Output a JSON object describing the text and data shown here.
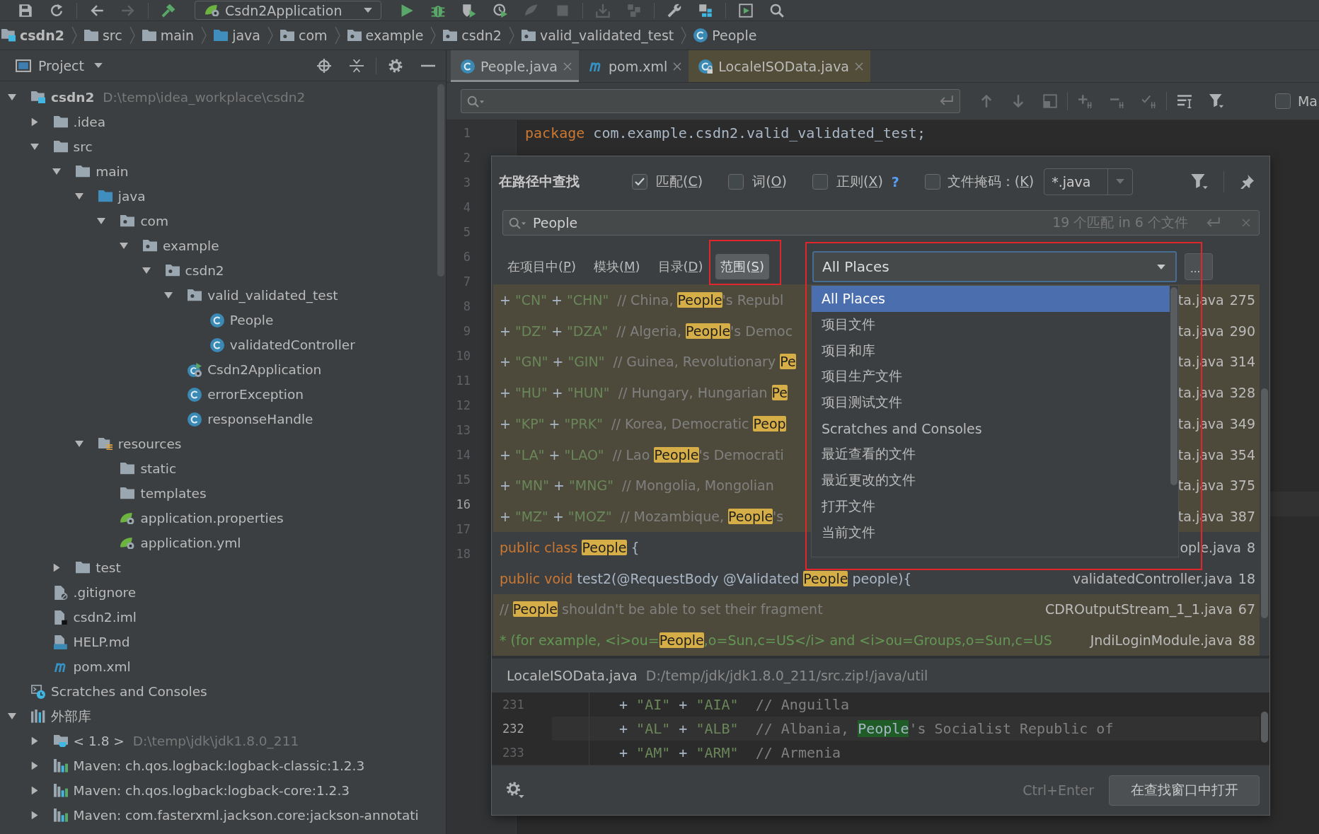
{
  "toolbar": {
    "left_buttons": [
      {
        "kind": "save",
        "disabled": false
      },
      {
        "kind": "refresh",
        "disabled": false
      },
      {
        "kind": "separator"
      },
      {
        "kind": "back",
        "disabled": false
      },
      {
        "kind": "forward",
        "disabled": true
      },
      {
        "kind": "separator"
      },
      {
        "kind": "build",
        "disabled": false
      }
    ],
    "run_configuration": "Csdn2Application",
    "right_buttons": [
      {
        "kind": "run",
        "disabled": false
      },
      {
        "kind": "debug",
        "disabled": false
      },
      {
        "kind": "coverage",
        "disabled": false
      },
      {
        "kind": "profile",
        "disabled": false
      },
      {
        "kind": "attach",
        "disabled": true
      },
      {
        "kind": "stop",
        "disabled": true
      },
      {
        "kind": "separator"
      },
      {
        "kind": "deploy",
        "disabled": true
      },
      {
        "kind": "modules",
        "disabled": true
      },
      {
        "kind": "separator"
      },
      {
        "kind": "settings",
        "disabled": false
      },
      {
        "kind": "structure",
        "disabled": false
      },
      {
        "kind": "separator"
      },
      {
        "kind": "run_window",
        "disabled": false
      },
      {
        "kind": "search",
        "disabled": false
      }
    ]
  },
  "breadcrumb": [
    {
      "label": "csdn2",
      "kind": "module"
    },
    {
      "label": "src",
      "kind": "folder"
    },
    {
      "label": "main",
      "kind": "folder"
    },
    {
      "label": "java",
      "kind": "source_folder"
    },
    {
      "label": "com",
      "kind": "package"
    },
    {
      "label": "example",
      "kind": "package"
    },
    {
      "label": "csdn2",
      "kind": "package"
    },
    {
      "label": "valid_validated_test",
      "kind": "package"
    },
    {
      "label": "People",
      "kind": "class"
    }
  ],
  "project_panel": {
    "title": "Project",
    "tree": [
      {
        "label": "csdn2",
        "kind": "module",
        "path": "D:\\temp\\idea_workplace\\csdn2",
        "expanded": true,
        "children": [
          {
            "label": ".idea",
            "kind": "folder",
            "expanded": false
          },
          {
            "label": "src",
            "kind": "folder",
            "expanded": true,
            "children": [
              {
                "label": "main",
                "kind": "folder",
                "expanded": true,
                "children": [
                  {
                    "label": "java",
                    "kind": "source_folder",
                    "expanded": true,
                    "children": [
                      {
                        "label": "com",
                        "kind": "package",
                        "expanded": true,
                        "children": [
                          {
                            "label": "example",
                            "kind": "package",
                            "expanded": true,
                            "children": [
                              {
                                "label": "csdn2",
                                "kind": "package",
                                "expanded": true,
                                "children": [
                                  {
                                    "label": "valid_validated_test",
                                    "kind": "package",
                                    "expanded": true,
                                    "children": [
                                      {
                                        "label": "People",
                                        "kind": "class"
                                      },
                                      {
                                        "label": "validatedController",
                                        "kind": "class"
                                      }
                                    ]
                                  },
                                  {
                                    "label": "Csdn2Application",
                                    "kind": "spring_class"
                                  },
                                  {
                                    "label": "errorException",
                                    "kind": "class"
                                  },
                                  {
                                    "label": "responseHandle",
                                    "kind": "class"
                                  }
                                ]
                              }
                            ]
                          }
                        ]
                      }
                    ]
                  },
                  {
                    "label": "resources",
                    "kind": "resources_folder",
                    "expanded": true,
                    "children": [
                      {
                        "label": "static",
                        "kind": "folder"
                      },
                      {
                        "label": "templates",
                        "kind": "folder"
                      },
                      {
                        "label": "application.properties",
                        "kind": "spring_config"
                      },
                      {
                        "label": "application.yml",
                        "kind": "spring_config"
                      }
                    ]
                  }
                ]
              },
              {
                "label": "test",
                "kind": "folder",
                "expanded": false
              }
            ]
          },
          {
            "label": ".gitignore",
            "kind": "ignore_file"
          },
          {
            "label": "csdn2.iml",
            "kind": "iml_file"
          },
          {
            "label": "HELP.md",
            "kind": "markdown_file"
          },
          {
            "label": "pom.xml",
            "kind": "maven_file"
          }
        ]
      },
      {
        "label": "Scratches and Consoles",
        "kind": "scratches"
      },
      {
        "label": "外部库",
        "kind": "libraries",
        "expanded": true,
        "children": [
          {
            "label": "< 1.8 >",
            "kind": "jdk",
            "path": "D:\\temp\\jdk\\jdk1.8.0_211",
            "expanded": false
          },
          {
            "label": "Maven: ch.qos.logback:logback-classic:1.2.3",
            "kind": "library",
            "expanded": false
          },
          {
            "label": "Maven: ch.qos.logback:logback-core:1.2.3",
            "kind": "library",
            "expanded": false
          },
          {
            "label": "Maven: com.fasterxml.jackson.core:jackson-annotati",
            "kind": "library",
            "expanded": false
          }
        ]
      }
    ]
  },
  "editor": {
    "tabs": [
      {
        "label": "People.java",
        "kind": "class",
        "selected": true,
        "library": false
      },
      {
        "label": "pom.xml",
        "kind": "maven_file",
        "selected": false,
        "library": false
      },
      {
        "label": "LocaleISOData.java",
        "kind": "locked_class",
        "selected": false,
        "library": true
      }
    ],
    "find_bar": {
      "match_case": {
        "label": "Ma",
        "checked": false
      }
    },
    "lines": [
      {
        "number": "1",
        "current": false,
        "code": [
          {
            "kind": "keyword",
            "text": "package"
          },
          {
            "kind": "plain",
            "text": " com.example.csdn2.valid_validated_test;"
          }
        ]
      },
      {
        "number": "2",
        "current": false
      },
      {
        "number": "3",
        "current": false
      },
      {
        "number": "4",
        "current": false
      },
      {
        "number": "5",
        "current": false
      },
      {
        "number": "6",
        "current": false
      },
      {
        "number": "7",
        "current": false
      },
      {
        "number": "8",
        "current": false
      },
      {
        "number": "9",
        "current": false
      },
      {
        "number": "10",
        "current": false
      },
      {
        "number": "11",
        "current": false
      },
      {
        "number": "12",
        "current": false
      },
      {
        "number": "13",
        "current": false
      },
      {
        "number": "14",
        "current": false
      },
      {
        "number": "15",
        "current": false
      },
      {
        "number": "16",
        "current": true
      },
      {
        "number": "17",
        "current": false
      },
      {
        "number": "18",
        "current": false
      }
    ]
  },
  "find_dialog": {
    "title": "在路径中查找",
    "options": [
      {
        "label": {
          "pre": "匹配(",
          "key": "C",
          "post": ")"
        },
        "checked": true
      },
      {
        "label": {
          "pre": "词(",
          "key": "O",
          "post": ")"
        },
        "checked": false
      },
      {
        "label": {
          "pre": "正则(",
          "key": "X",
          "post": ")"
        },
        "checked": false,
        "help": "?"
      }
    ],
    "file_mask": {
      "label": {
        "pre": "文件掩码：(",
        "key": "K",
        "post": ")"
      },
      "checked": false,
      "value": "*.java"
    },
    "query": "People",
    "match_count": "19 个匹配 in 6 个文件",
    "scopes": [
      {
        "label": {
          "pre": "在项目中(",
          "key": "P",
          "post": ")"
        },
        "selected": false,
        "framed": false
      },
      {
        "label": {
          "pre": "模块(",
          "key": "M",
          "post": ")"
        },
        "selected": false,
        "framed": false
      },
      {
        "label": {
          "pre": "目录(",
          "key": "D",
          "post": ")"
        },
        "selected": false,
        "framed": false
      },
      {
        "label": {
          "pre": "范围(",
          "key": "S",
          "post": ")"
        },
        "selected": true,
        "framed": true
      }
    ],
    "scope_picker": {
      "value": "All Places",
      "framed": true,
      "more_button": "...",
      "menu": [
        {
          "label": "All Places",
          "selected": true
        },
        {
          "label": "项目文件",
          "selected": false
        },
        {
          "label": "项目和库",
          "selected": false
        },
        {
          "label": "项目生产文件",
          "selected": false
        },
        {
          "label": "项目测试文件",
          "selected": false
        },
        {
          "label": "Scratches and Consoles",
          "selected": false
        },
        {
          "label": "最近查看的文件",
          "selected": false
        },
        {
          "label": "最近更改的文件",
          "selected": false
        },
        {
          "label": "打开文件",
          "selected": false
        },
        {
          "label": "当前文件",
          "selected": false
        }
      ]
    },
    "results": [
      {
        "library": true,
        "tokens": [
          {
            "kind": "op",
            "text": "+ "
          },
          {
            "kind": "string",
            "text": "\"CN\""
          },
          {
            "kind": "op",
            "text": " + "
          },
          {
            "kind": "string",
            "text": "\"CHN\""
          },
          {
            "kind": "comment",
            "text": "  // China, "
          },
          {
            "kind": "match",
            "text": "People"
          },
          {
            "kind": "comment",
            "text": "'s Republ"
          }
        ],
        "file": "ta.java",
        "line": "275"
      },
      {
        "library": true,
        "tokens": [
          {
            "kind": "op",
            "text": "+ "
          },
          {
            "kind": "string",
            "text": "\"DZ\""
          },
          {
            "kind": "op",
            "text": " + "
          },
          {
            "kind": "string",
            "text": "\"DZA\""
          },
          {
            "kind": "comment",
            "text": "  // Algeria, "
          },
          {
            "kind": "match",
            "text": "People"
          },
          {
            "kind": "comment",
            "text": "'s Democ"
          }
        ],
        "file": "ta.java",
        "line": "290"
      },
      {
        "library": true,
        "tokens": [
          {
            "kind": "op",
            "text": "+ "
          },
          {
            "kind": "string",
            "text": "\"GN\""
          },
          {
            "kind": "op",
            "text": " + "
          },
          {
            "kind": "string",
            "text": "\"GIN\""
          },
          {
            "kind": "comment",
            "text": "  // Guinea, Revolutionary "
          },
          {
            "kind": "match",
            "text": "Pe"
          }
        ],
        "file": "ta.java",
        "line": "314"
      },
      {
        "library": true,
        "tokens": [
          {
            "kind": "op",
            "text": "+ "
          },
          {
            "kind": "string",
            "text": "\"HU\""
          },
          {
            "kind": "op",
            "text": " + "
          },
          {
            "kind": "string",
            "text": "\"HUN\""
          },
          {
            "kind": "comment",
            "text": "  // Hungary, Hungarian "
          },
          {
            "kind": "match",
            "text": "Pe"
          }
        ],
        "file": "ta.java",
        "line": "328"
      },
      {
        "library": true,
        "tokens": [
          {
            "kind": "op",
            "text": "+ "
          },
          {
            "kind": "string",
            "text": "\"KP\""
          },
          {
            "kind": "op",
            "text": " + "
          },
          {
            "kind": "string",
            "text": "\"PRK\""
          },
          {
            "kind": "comment",
            "text": "  // Korea, Democratic "
          },
          {
            "kind": "match",
            "text": "Peop"
          }
        ],
        "file": "ta.java",
        "line": "349"
      },
      {
        "library": true,
        "tokens": [
          {
            "kind": "op",
            "text": "+ "
          },
          {
            "kind": "string",
            "text": "\"LA\""
          },
          {
            "kind": "op",
            "text": " + "
          },
          {
            "kind": "string",
            "text": "\"LAO\""
          },
          {
            "kind": "comment",
            "text": "  // Lao "
          },
          {
            "kind": "match",
            "text": "People"
          },
          {
            "kind": "comment",
            "text": "'s Democrati"
          }
        ],
        "file": "ta.java",
        "line": "354"
      },
      {
        "library": true,
        "tokens": [
          {
            "kind": "op",
            "text": "+ "
          },
          {
            "kind": "string",
            "text": "\"MN\""
          },
          {
            "kind": "op",
            "text": " + "
          },
          {
            "kind": "string",
            "text": "\"MNG\""
          },
          {
            "kind": "comment",
            "text": "  // Mongolia, Mongolian"
          }
        ],
        "file": "ta.java",
        "line": "375"
      },
      {
        "library": true,
        "tokens": [
          {
            "kind": "op",
            "text": "+ "
          },
          {
            "kind": "string",
            "text": "\"MZ\""
          },
          {
            "kind": "op",
            "text": " + "
          },
          {
            "kind": "string",
            "text": "\"MOZ\""
          },
          {
            "kind": "comment",
            "text": "  // Mozambique, "
          },
          {
            "kind": "match",
            "text": "People"
          },
          {
            "kind": "comment",
            "text": "'s"
          }
        ],
        "file": "ta.java",
        "line": "387"
      },
      {
        "library": false,
        "tokens": [
          {
            "kind": "keyword",
            "text": "public class "
          },
          {
            "kind": "match",
            "text": "People"
          },
          {
            "kind": "plain",
            "text": " {"
          }
        ],
        "file": "ople.java",
        "line": "8"
      },
      {
        "library": false,
        "tokens": [
          {
            "kind": "keyword",
            "text": "public void "
          },
          {
            "kind": "plain",
            "text": "test2(@RequestBody @Validated "
          },
          {
            "kind": "match",
            "text": "People"
          },
          {
            "kind": "plain",
            "text": " people){"
          }
        ],
        "file": "validatedController.java",
        "line": "18"
      },
      {
        "library": true,
        "tokens": [
          {
            "kind": "comment",
            "text": "// "
          },
          {
            "kind": "match",
            "text": "People"
          },
          {
            "kind": "comment",
            "text": " shouldn't be able to set their fragment"
          }
        ],
        "file": "CDROutputStream_1_1.java",
        "line": "67"
      },
      {
        "library": true,
        "tokens": [
          {
            "kind": "doc",
            "text": "* (for example, <i>ou="
          },
          {
            "kind": "match",
            "text": "People"
          },
          {
            "kind": "doc",
            "text": ",o=Sun,c=US</i> and <i>ou=Groups,o=Sun,c=US"
          }
        ],
        "file": "JndiLoginModule.java",
        "line": "88"
      }
    ],
    "preview": {
      "file": "LocaleISOData.java",
      "path": "D:/temp/jdk/jdk1.8.0_211/src.zip!/java/util",
      "lines": [
        {
          "number": "231",
          "current": false,
          "tokens": [
            {
              "kind": "op",
              "text": "+ "
            },
            {
              "kind": "string",
              "text": "\"AI\""
            },
            {
              "kind": "op",
              "text": " + "
            },
            {
              "kind": "string",
              "text": "\"AIA\""
            },
            {
              "kind": "comment",
              "text": "  // Anguilla"
            }
          ]
        },
        {
          "number": "232",
          "current": true,
          "tokens": [
            {
              "kind": "op",
              "text": "+ "
            },
            {
              "kind": "string",
              "text": "\"AL\""
            },
            {
              "kind": "op",
              "text": " + "
            },
            {
              "kind": "string",
              "text": "\"ALB\""
            },
            {
              "kind": "comment",
              "text": "  // Albania, "
            },
            {
              "kind": "match",
              "text": "People"
            },
            {
              "kind": "comment",
              "text": "'s Socialist Republic of"
            }
          ]
        },
        {
          "number": "233",
          "current": false,
          "tokens": [
            {
              "kind": "op",
              "text": "+ "
            },
            {
              "kind": "string",
              "text": "\"AM\""
            },
            {
              "kind": "op",
              "text": " + "
            },
            {
              "kind": "string",
              "text": "\"ARM\""
            },
            {
              "kind": "comment",
              "text": "  // Armenia"
            }
          ]
        }
      ]
    },
    "shortcut_hint": "Ctrl+Enter",
    "open_button": "在查找窗口中打开"
  }
}
